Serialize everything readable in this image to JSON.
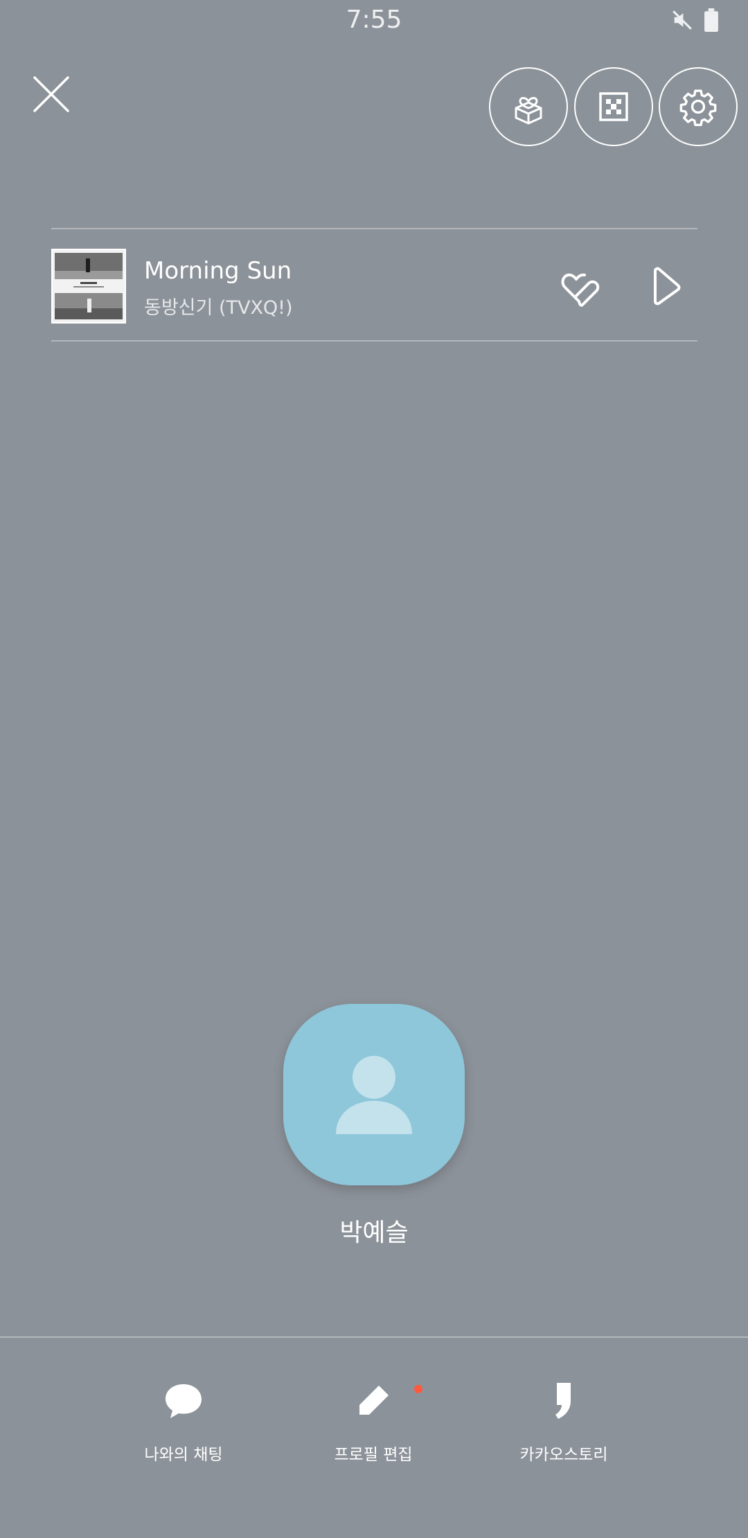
{
  "status_bar": {
    "time": "7:55",
    "icons": [
      "mute-icon",
      "battery-icon"
    ]
  },
  "top_bar": {
    "buttons": [
      "close-icon",
      "gift-icon",
      "qr-code-icon",
      "gear-icon"
    ]
  },
  "music": {
    "title": "Morning Sun",
    "artist": "동방신기 (TVXQ!)",
    "icons": [
      "like-icon",
      "play-icon"
    ]
  },
  "profile": {
    "name": "박예슬",
    "avatar_color": "#8ec7da"
  },
  "bottom_actions": [
    {
      "label": "나와의 채팅",
      "icon": "chat-bubble-icon"
    },
    {
      "label": "프로필 편집",
      "icon": "pencil-icon",
      "notification": true
    },
    {
      "label": "카카오스토리",
      "icon": "kakaostory-icon"
    }
  ],
  "colors": {
    "background": "#8c9299",
    "notification_dot": "#ff5a3c"
  }
}
